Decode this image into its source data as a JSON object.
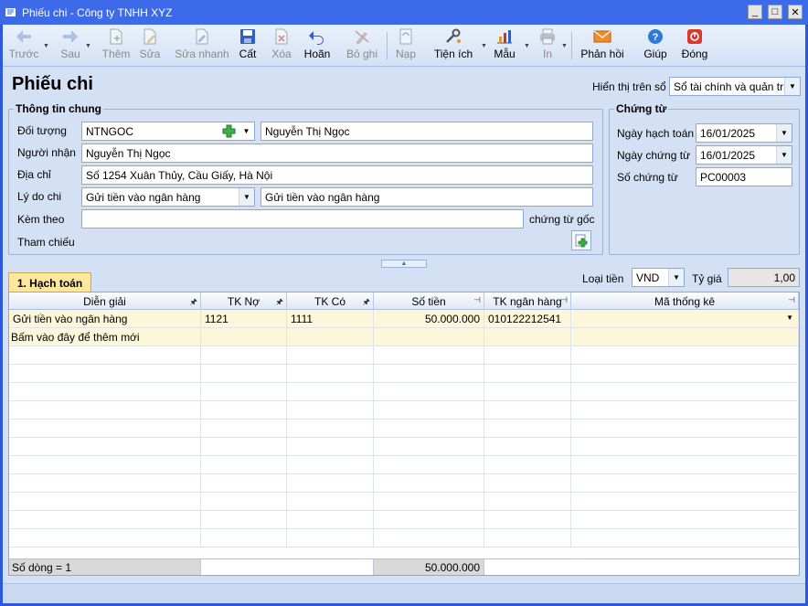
{
  "window": {
    "title": "Phiếu chi - Công ty TNHH XYZ"
  },
  "toolbar": [
    {
      "label": "Trước",
      "icon": "arrow-left-icon",
      "enabled": false,
      "dropdown": true
    },
    {
      "label": "Sau",
      "icon": "arrow-right-icon",
      "enabled": false,
      "dropdown": true
    },
    {
      "label": "Thêm",
      "icon": "add-document-icon",
      "enabled": false
    },
    {
      "label": "Sửa",
      "icon": "edit-document-icon",
      "enabled": false
    },
    {
      "label": "Sửa nhanh",
      "icon": "quick-edit-icon",
      "enabled": false
    },
    {
      "label": "Cất",
      "icon": "save-icon",
      "enabled": true
    },
    {
      "label": "Xóa",
      "icon": "delete-icon",
      "enabled": false
    },
    {
      "label": "Hoãn",
      "icon": "undo-icon",
      "enabled": true
    },
    {
      "label": "Bỏ ghi",
      "icon": "unpost-icon",
      "enabled": false
    },
    {
      "label": "Nạp",
      "icon": "reload-icon",
      "enabled": false
    },
    {
      "label": "Tiện ích",
      "icon": "utilities-icon",
      "enabled": true,
      "dropdown": true
    },
    {
      "label": "Mẫu",
      "icon": "template-icon",
      "enabled": true,
      "dropdown": true
    },
    {
      "label": "In",
      "icon": "print-icon",
      "enabled": false,
      "dropdown": true
    },
    {
      "label": "Phản hồi",
      "icon": "feedback-mail-icon",
      "enabled": true
    },
    {
      "label": "Giúp",
      "icon": "help-icon",
      "enabled": true
    },
    {
      "label": "Đóng",
      "icon": "close-icon",
      "enabled": true
    }
  ],
  "page_title": "Phiếu chi",
  "display_on_book": {
    "label": "Hiển thị trên sổ",
    "value": "Sổ tài chính và quản trị"
  },
  "general_info": {
    "title": "Thông tin chung",
    "doi_tuong": {
      "label": "Đối tượng",
      "code": "NTNGOC",
      "name": "Nguyễn Thị Ngọc"
    },
    "nguoi_nhan": {
      "label": "Người nhận",
      "value": "Nguyễn Thị Ngọc"
    },
    "dia_chi": {
      "label": "Địa chỉ",
      "value": "Số 1254 Xuân Thủy, Cầu Giấy, Hà Nội"
    },
    "ly_do_chi": {
      "label": "Lý do chi",
      "value": "Gửi tiền vào ngân hàng",
      "text": "Gửi tiền vào ngân hàng"
    },
    "kem_theo": {
      "label": "Kèm theo",
      "value": "",
      "suffix": "chứng từ gốc"
    },
    "tham_chieu": {
      "label": "Tham chiếu"
    }
  },
  "voucher": {
    "title": "Chứng từ",
    "ngay_hach_toan": {
      "label": "Ngày hạch toán",
      "value": "16/01/2025"
    },
    "ngay_chung_tu": {
      "label": "Ngày chứng từ",
      "value": "16/01/2025"
    },
    "so_chung_tu": {
      "label": "Số chứng từ",
      "value": "PC00003"
    }
  },
  "tab": {
    "label": "1. Hạch toán"
  },
  "currency": {
    "label": "Loại tiền",
    "value": "VND"
  },
  "rate": {
    "label": "Tỷ giá",
    "value": "1,00"
  },
  "grid": {
    "columns": [
      "Diễn giải",
      "TK Nợ",
      "TK Có",
      "Số tiền",
      "TK ngân hàng",
      "Mã thống kê"
    ],
    "rows": [
      {
        "dien_giai": "Gửi tiền vào ngân hàng",
        "tk_no": "1121",
        "tk_co": "1111",
        "so_tien": "50.000.000",
        "tk_ngan_hang": "010122212541",
        "ma_thong_ke": ""
      }
    ],
    "new_row_hint": "Bấm vào đây để thêm mới",
    "footer_count": "Số dòng = 1",
    "footer_total": "50.000.000"
  }
}
